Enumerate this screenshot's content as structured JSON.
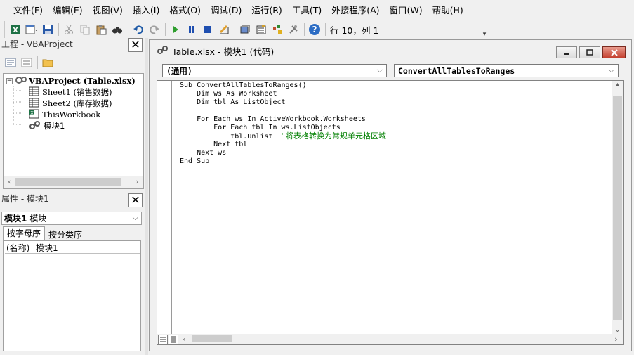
{
  "menubar": {
    "items": [
      "文件(F)",
      "编辑(E)",
      "视图(V)",
      "插入(I)",
      "格式(O)",
      "调试(D)",
      "运行(R)",
      "工具(T)",
      "外接程序(A)",
      "窗口(W)",
      "帮助(H)"
    ]
  },
  "toolbar": {
    "status": "行 10，列 1"
  },
  "project_panel": {
    "title": "工程 - VBAProject",
    "tree": {
      "root": "VBAProject (Table.xlsx)",
      "items": [
        "Sheet1 (销售数据)",
        "Sheet2 (库存数据)",
        "ThisWorkbook",
        "模块1"
      ]
    }
  },
  "properties_panel": {
    "title": "属性 - 模块1",
    "object_name": "模块1",
    "object_type": "模块",
    "tabs": [
      "按字母序",
      "按分类序"
    ],
    "rows": [
      {
        "key": "(名称)",
        "value": "模块1"
      }
    ]
  },
  "code_window": {
    "title": "Table.xlsx - 模块1 (代码)",
    "object_combo": "(通用)",
    "procedure_combo": "ConvertAllTablesToRanges",
    "lines": [
      {
        "code": "Sub ConvertAllTablesToRanges()",
        "comment": ""
      },
      {
        "code": "    Dim ws As Worksheet",
        "comment": ""
      },
      {
        "code": "    Dim tbl As ListObject",
        "comment": ""
      },
      {
        "code": "",
        "comment": ""
      },
      {
        "code": "    For Each ws In ActiveWorkbook.Worksheets",
        "comment": ""
      },
      {
        "code": "        For Each tbl In ws.ListObjects",
        "comment": ""
      },
      {
        "code": "            tbl.Unlist  ",
        "comment": "' 将表格转换为常规单元格区域"
      },
      {
        "code": "        Next tbl",
        "comment": ""
      },
      {
        "code": "    Next ws",
        "comment": ""
      },
      {
        "code": "End Sub",
        "comment": ""
      }
    ]
  },
  "colors": {
    "comment": "#008000",
    "chrome": "#f0f0f0",
    "run_green": "#2f9e2f",
    "stop_blue": "#1f4fb0",
    "help_blue": "#2b6cc4"
  }
}
